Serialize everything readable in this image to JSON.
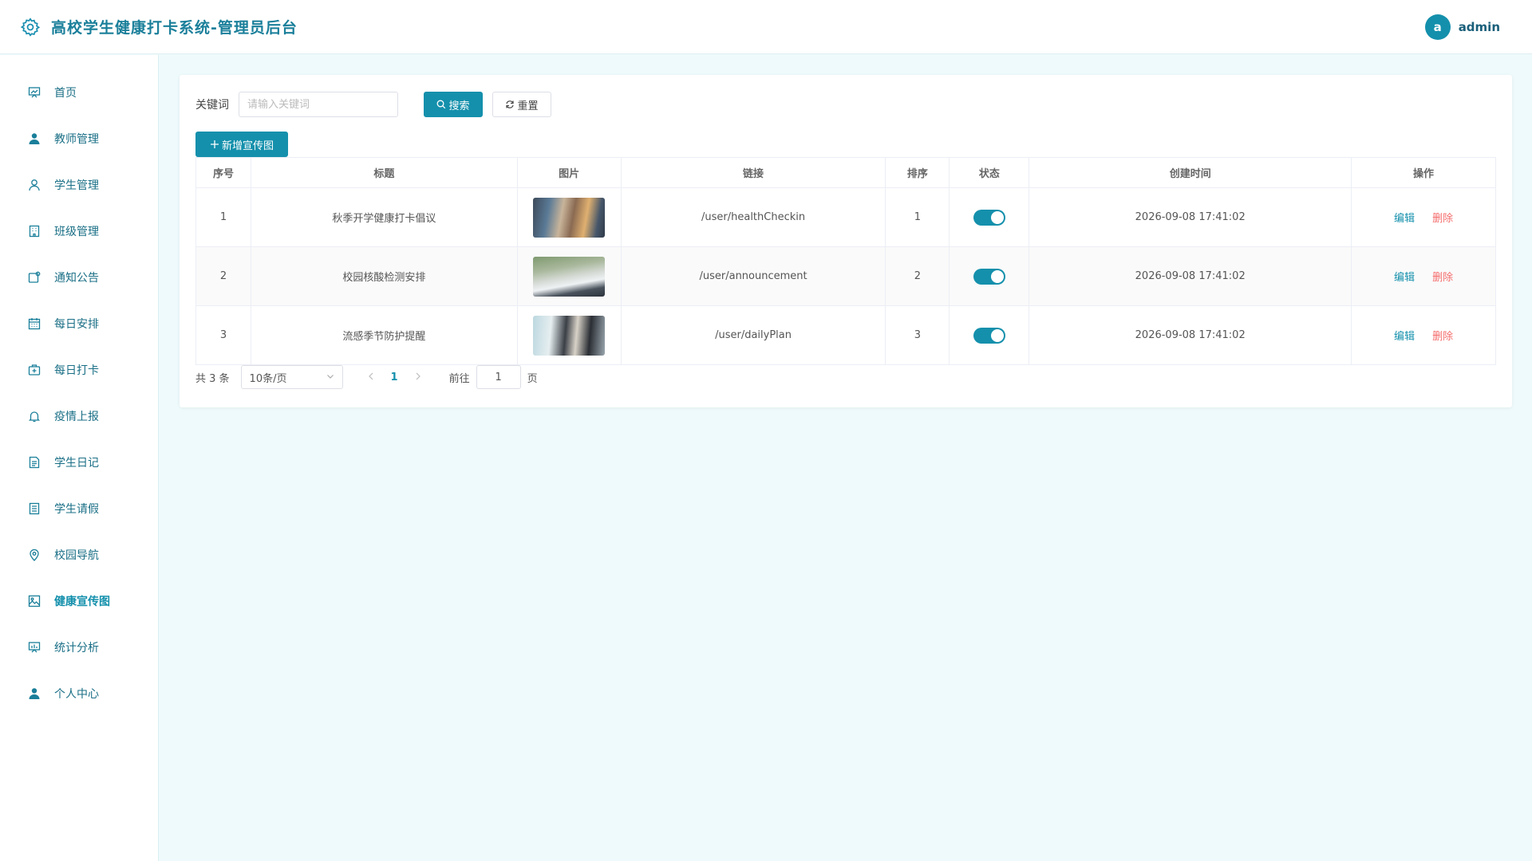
{
  "header": {
    "title": "高校学生健康打卡系统-管理员后台",
    "logo_icon": "gear-icon",
    "avatar_letter": "a",
    "username": "admin"
  },
  "sidebar": {
    "items": [
      {
        "label": "首页",
        "icon": "dashboard-icon",
        "active": false
      },
      {
        "label": "教师管理",
        "icon": "user-filled-icon",
        "active": false
      },
      {
        "label": "学生管理",
        "icon": "user-icon",
        "active": false
      },
      {
        "label": "班级管理",
        "icon": "office-building-icon",
        "active": false
      },
      {
        "label": "通知公告",
        "icon": "notice-icon",
        "active": false
      },
      {
        "label": "每日安排",
        "icon": "calendar-icon",
        "active": false
      },
      {
        "label": "每日打卡",
        "icon": "first-aid-kit-icon",
        "active": false
      },
      {
        "label": "疫情上报",
        "icon": "bell-icon",
        "active": false
      },
      {
        "label": "学生日记",
        "icon": "document-icon",
        "active": false
      },
      {
        "label": "学生请假",
        "icon": "tickets-icon",
        "active": false
      },
      {
        "label": "校园导航",
        "icon": "location-icon",
        "active": false
      },
      {
        "label": "健康宣传图",
        "icon": "picture-icon",
        "active": true
      },
      {
        "label": "统计分析",
        "icon": "data-board-icon",
        "active": false
      },
      {
        "label": "个人中心",
        "icon": "user-filled-icon",
        "active": false
      }
    ]
  },
  "search": {
    "label": "关键词",
    "placeholder": "请输入关键词",
    "value": "",
    "search_button": "搜索",
    "reset_button": "重置"
  },
  "toolbar": {
    "add_button": "新增宣传图"
  },
  "table": {
    "columns": [
      "序号",
      "标题",
      "图片",
      "链接",
      "排序",
      "状态",
      "创建时间",
      "操作"
    ],
    "rows": [
      {
        "index": "1",
        "title": "秋季开学健康打卡倡议",
        "link": "/user/healthCheckin",
        "sort": "1",
        "status": true,
        "created": "2026-09-08 17:41:02",
        "edit": "编辑",
        "delete": "删除"
      },
      {
        "index": "2",
        "title": "校园核酸检测安排",
        "link": "/user/announcement",
        "sort": "2",
        "status": true,
        "created": "2026-09-08 17:41:02",
        "edit": "编辑",
        "delete": "删除"
      },
      {
        "index": "3",
        "title": "流感季节防护提醒",
        "link": "/user/dailyPlan",
        "sort": "3",
        "status": true,
        "created": "2026-09-08 17:41:02",
        "edit": "编辑",
        "delete": "删除"
      }
    ]
  },
  "pagination": {
    "total_text": "共 3 条",
    "page_size": "10条/页",
    "current_page": "1",
    "goto_label": "前往",
    "goto_value": "1",
    "page_unit": "页"
  },
  "colors": {
    "primary": "#1490ac",
    "danger": "#f56c6c",
    "background": "#eefafb"
  }
}
